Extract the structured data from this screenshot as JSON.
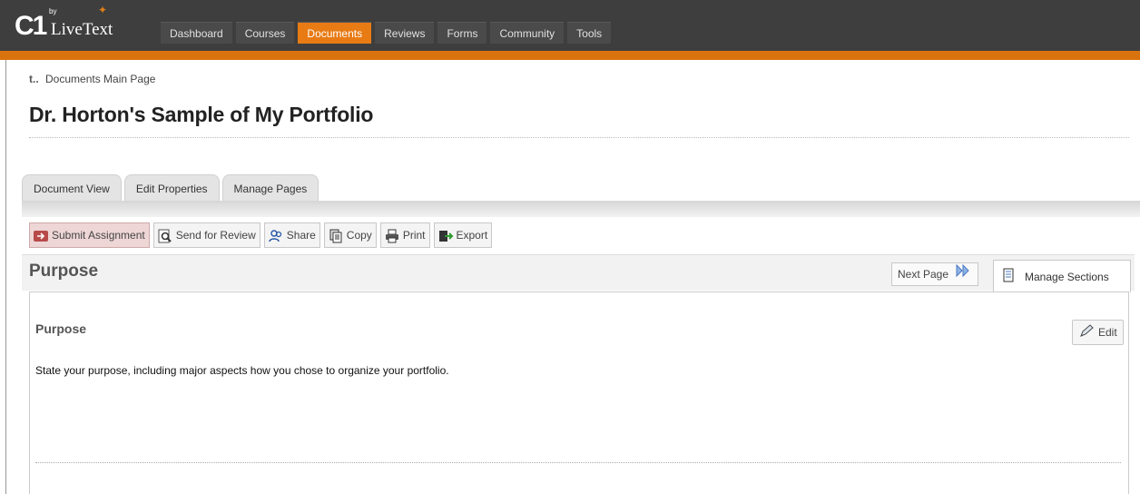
{
  "logo": {
    "mark": "C1",
    "by": "by",
    "name": "LiveText"
  },
  "nav": {
    "items": [
      {
        "label": "Dashboard",
        "active": false
      },
      {
        "label": "Courses",
        "active": false
      },
      {
        "label": "Documents",
        "active": true
      },
      {
        "label": "Reviews",
        "active": false
      },
      {
        "label": "Forms",
        "active": false
      },
      {
        "label": "Community",
        "active": false
      },
      {
        "label": "Tools",
        "active": false
      }
    ]
  },
  "breadcrumb": {
    "arrow": "t..",
    "label": "Documents Main Page"
  },
  "page": {
    "title": "Dr. Horton's Sample of My Portfolio"
  },
  "tabs": [
    {
      "label": "Document View"
    },
    {
      "label": "Edit Properties"
    },
    {
      "label": "Manage Pages"
    }
  ],
  "toolbar": {
    "submit": "Submit Assignment",
    "review": "Send for Review",
    "share": "Share",
    "copy": "Copy",
    "print": "Print",
    "export": "Export"
  },
  "section": {
    "title": "Purpose",
    "next_page": "Next Page",
    "manage_sections": "Manage Sections"
  },
  "content": {
    "heading": "Purpose",
    "edit": "Edit",
    "text": "State your purpose, including major aspects how you chose to organize your portfolio."
  },
  "colors": {
    "accent": "#e87b14",
    "topbar": "#3e3e3e"
  }
}
